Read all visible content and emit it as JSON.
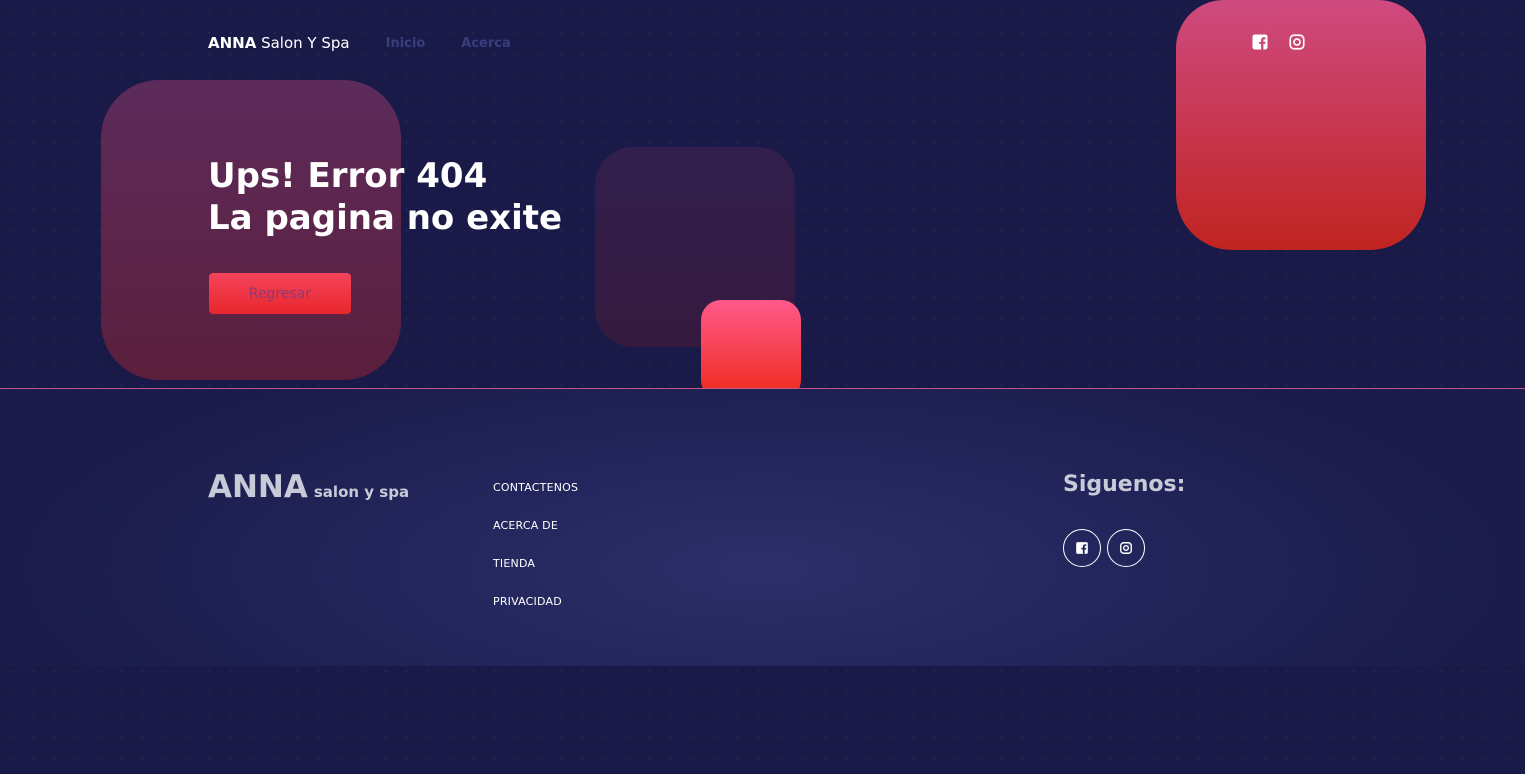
{
  "nav": {
    "brand_bold": "ANNA",
    "brand_rest": " Salon Y Spa",
    "links": [
      "Inicio",
      "Acerca"
    ],
    "social_icons": [
      "facebook-icon",
      "instagram-icon"
    ]
  },
  "hero": {
    "line1": "Ups! Error 404",
    "line2": "La pagina no exite",
    "back_button": "Regresar"
  },
  "footer": {
    "brand_big": "ANNA",
    "brand_small": "salon y spa",
    "links": [
      "CONTACTENOS",
      "ACERCA DE",
      "TIENDA",
      "PRIVACIDAD"
    ],
    "follow_title": "Siguenos:",
    "social_icons": [
      "facebook-icon",
      "instagram-icon"
    ]
  },
  "colors": {
    "background": "#191a48",
    "accent_red": "#e8262d",
    "accent_pink": "#cf4a80",
    "nav_link": "#373e7c"
  }
}
